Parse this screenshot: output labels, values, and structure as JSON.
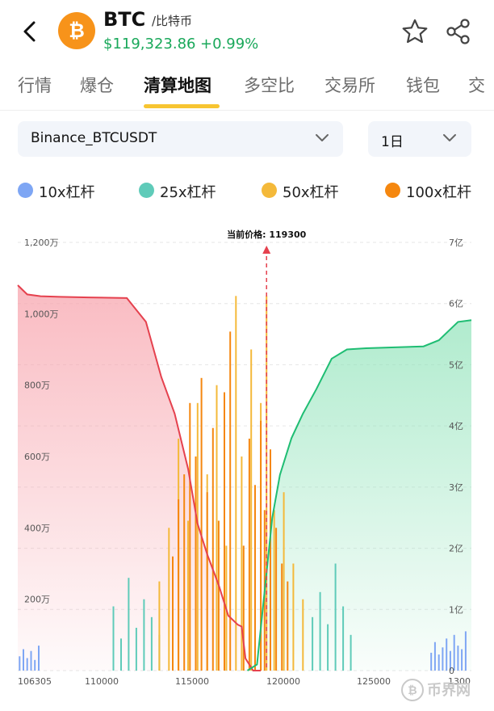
{
  "header": {
    "symbol": "BTC",
    "fullname": "/比特币",
    "price": "$119,323.86",
    "change": "+0.99%",
    "coin_glyph": "₿",
    "icons": [
      "back-arrow-icon",
      "star-icon",
      "share-icon",
      "bitcoin-logo-icon"
    ],
    "accent_color": "#f7931a",
    "up_color": "#19a85a"
  },
  "tabs": [
    {
      "label": "行情",
      "active": false
    },
    {
      "label": "爆仓",
      "active": false
    },
    {
      "label": "清算地图",
      "active": true
    },
    {
      "label": "多空比",
      "active": false
    },
    {
      "label": "交易所",
      "active": false
    },
    {
      "label": "钱包",
      "active": false
    },
    {
      "label": "交",
      "active": false
    }
  ],
  "filters": {
    "pair": "Binance_BTCUSDT",
    "period": "1日"
  },
  "legend": [
    {
      "label": "10x杠杆",
      "color": "#7ea6f4"
    },
    {
      "label": "25x杠杆",
      "color": "#5fcbb9"
    },
    {
      "label": "50x杠杆",
      "color": "#f4b93a"
    },
    {
      "label": "100x杠杆",
      "color": "#f5870f"
    }
  ],
  "watermark": {
    "text": "币界网",
    "glyph": "₿"
  },
  "chart_data": {
    "type": "bar",
    "current_price_label": "当前价格: 119300",
    "current_price": 119300,
    "x_ticks": [
      "106305",
      "110000",
      "115000",
      "120000",
      "125000",
      "1300"
    ],
    "xlim": [
      106305,
      130000
    ],
    "y_left_ticks": [
      "200万",
      "400万",
      "600万",
      "800万",
      "1,000万",
      "1,200万"
    ],
    "y_left_range": [
      0,
      12000000
    ],
    "y_right_ticks": [
      "0",
      "1亿",
      "2亿",
      "3亿",
      "4亿",
      "5亿",
      "6亿",
      "7亿"
    ],
    "y_right_range": [
      0,
      700000000
    ],
    "grid": true,
    "series": [
      {
        "name": "10x杠杆",
        "color": "#7ea6f4",
        "x": [
          106400,
          106600,
          106800,
          107000,
          107200,
          107400,
          127900,
          128100,
          128300,
          128500,
          128700,
          128900,
          129100,
          129300,
          129500,
          129700
        ],
        "values": [
          400000,
          600000,
          350000,
          550000,
          300000,
          700000,
          500000,
          800000,
          450000,
          650000,
          900000,
          550000,
          1000000,
          700000,
          600000,
          1100000
        ]
      },
      {
        "name": "25x杠杆",
        "color": "#5fcbb9",
        "x": [
          111300,
          111700,
          112100,
          112500,
          112900,
          113300,
          113700,
          121700,
          122100,
          122500,
          122900,
          123300,
          123700
        ],
        "values": [
          1800000,
          900000,
          2600000,
          1200000,
          2000000,
          1500000,
          1000000,
          1500000,
          2200000,
          1300000,
          3000000,
          1800000,
          1000000
        ]
      },
      {
        "name": "50x杠杆",
        "color": "#f4b93a",
        "x": [
          113700,
          114200,
          114700,
          115200,
          115700,
          116200,
          116700,
          117200,
          117700,
          118000,
          118500,
          119000,
          119300,
          119700,
          120200,
          120700,
          121200
        ],
        "values": [
          2500000,
          4000000,
          6500000,
          4200000,
          7500000,
          5500000,
          8000000,
          3500000,
          10500000,
          6000000,
          9000000,
          7500000,
          10500000,
          4500000,
          5000000,
          3000000,
          2000000
        ]
      },
      {
        "name": "100x杠杆",
        "color": "#f5870f",
        "x": [
          114400,
          114700,
          115000,
          115300,
          115600,
          115900,
          116200,
          116500,
          116800,
          117100,
          117400,
          118100,
          118400,
          118700,
          119000,
          119200,
          119500,
          119800,
          120100,
          120400
        ],
        "values": [
          3200000,
          4800000,
          5500000,
          7500000,
          6000000,
          8200000,
          5000000,
          6800000,
          4200000,
          7800000,
          9500000,
          3500000,
          6500000,
          5200000,
          7000000,
          4500000,
          6200000,
          4000000,
          3000000,
          2500000
        ]
      },
      {
        "name": "short_cumulative",
        "color": "#e5414e",
        "x": [
          106305,
          106800,
          107500,
          108500,
          110000,
          112000,
          113000,
          113800,
          114500,
          115200,
          115700,
          116200,
          116800,
          117300,
          117800,
          118000,
          118200,
          118600,
          119000
        ],
        "values": [
          630000000,
          615000000,
          612000000,
          611000000,
          610000000,
          609000000,
          570000000,
          480000000,
          420000000,
          330000000,
          240000000,
          190000000,
          140000000,
          90000000,
          75000000,
          72000000,
          20000000,
          0,
          0
        ]
      },
      {
        "name": "long_cumulative",
        "color": "#1fbd73",
        "x": [
          118300,
          118800,
          119300,
          119600,
          120000,
          120600,
          121200,
          121900,
          122700,
          123500,
          124500,
          125500,
          126500,
          127500,
          128300,
          128800,
          129300,
          130000
        ],
        "values": [
          0,
          10000000,
          160000000,
          250000000,
          320000000,
          380000000,
          420000000,
          460000000,
          510000000,
          525000000,
          527000000,
          528000000,
          529000000,
          530000000,
          540000000,
          555000000,
          570000000,
          573000000
        ]
      }
    ]
  }
}
